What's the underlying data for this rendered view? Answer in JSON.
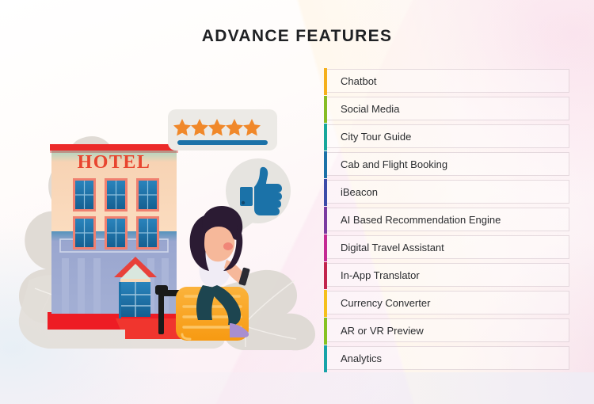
{
  "header": {
    "title": "ADVANCE FEATURES"
  },
  "features": {
    "items": [
      {
        "label": "Chatbot",
        "accent": "#f5b01b"
      },
      {
        "label": "Social Media",
        "accent": "#86bc25"
      },
      {
        "label": "City Tour Guide",
        "accent": "#17a79b"
      },
      {
        "label": "Cab and Flight Booking",
        "accent": "#1b72a8"
      },
      {
        "label": "iBeacon",
        "accent": "#3b4ba8"
      },
      {
        "label": "AI Based Recommendation Engine",
        "accent": "#7a3ba0"
      },
      {
        "label": "Digital Travel Assistant",
        "accent": "#c42a93"
      },
      {
        "label": "In-App Translator",
        "accent": "#c2244c"
      },
      {
        "label": "Currency Converter",
        "accent": "#f5c01b"
      },
      {
        "label": "AR or VR Preview",
        "accent": "#86c222"
      },
      {
        "label": "Analytics",
        "accent": "#17a3a8"
      }
    ]
  },
  "illustration": {
    "hotel_sign_text": "HOTEL",
    "review_card": {
      "star_count": 5,
      "star_color": "#f0882a",
      "bar_color": "#1b72a8",
      "card_color": "#eceae6"
    },
    "thumbs_up": {
      "bubble_color": "#e6e4e0",
      "hand_color": "#1b72a8"
    },
    "building": {
      "facade_color": "#fbd9b8",
      "roof_band_color": "#ec2a2a",
      "sign_color": "#e8452f",
      "window_glass_color": "#1b72a8",
      "window_frame_color": "#f08070",
      "base_color": "#97a3cc",
      "entrance_roof_color": "#e8413a",
      "door_color": "#1b6fa5",
      "carpet_color": "#ed1c24"
    },
    "person": {
      "hair_color": "#2b1b33",
      "skin_color": "#f6b89a",
      "top_color": "#f0ecf5",
      "jeans_color": "#1d4550",
      "phone_color": "#2b2b33"
    },
    "suitcase": {
      "body_color": "#f9a21b",
      "highlight_color": "#fbb843",
      "handle_color": "#1a1a1a"
    },
    "foliage_color": "#dedad4"
  }
}
